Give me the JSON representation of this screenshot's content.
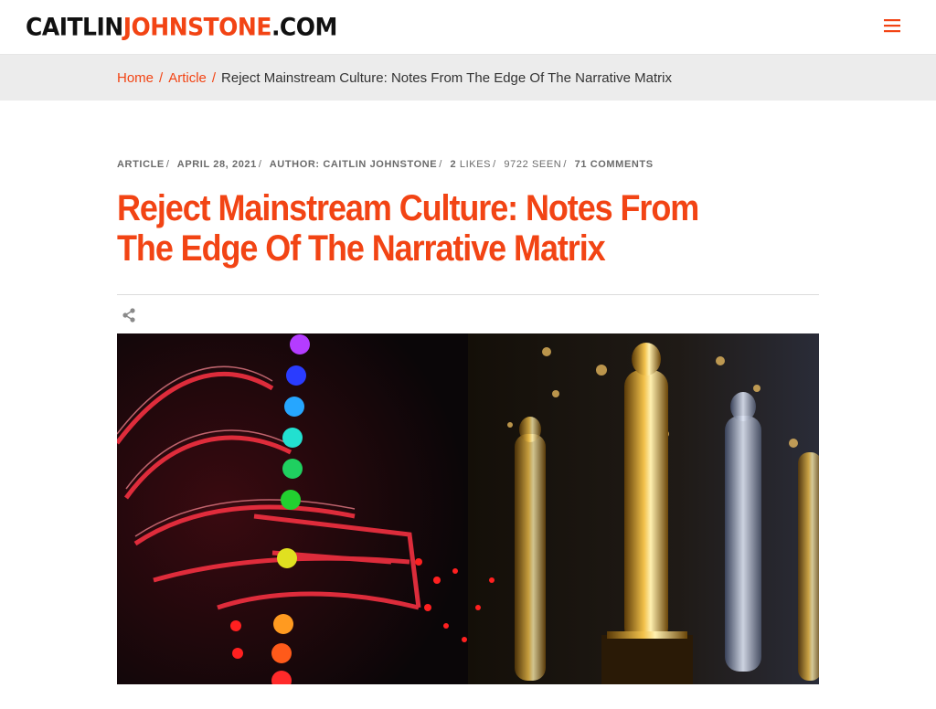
{
  "site": {
    "logo_part1": "CAITLIN",
    "logo_part2": "JOHNSTONE",
    "logo_part3": ".COM",
    "menu_icon": "hamburger-icon"
  },
  "breadcrumb": {
    "home": "Home",
    "section": "Article",
    "separator": "/",
    "current": "Reject Mainstream Culture: Notes From The Edge Of The Narrative Matrix"
  },
  "meta": {
    "category": "ARTICLE",
    "date": "APRIL 28, 2021",
    "author": "AUTHOR: CAITLIN JOHNSTONE",
    "likes_count": "2",
    "likes_label": "LIKES",
    "seen": "9722 SEEN",
    "comments": "71 COMMENTS",
    "separator": "/"
  },
  "article": {
    "title": "Reject Mainstream Culture: Notes From The Edge Of The Narrative Matrix",
    "share_icon": "share-icon"
  },
  "colors": {
    "accent": "#f24414",
    "crumb_bg": "#ececec"
  }
}
